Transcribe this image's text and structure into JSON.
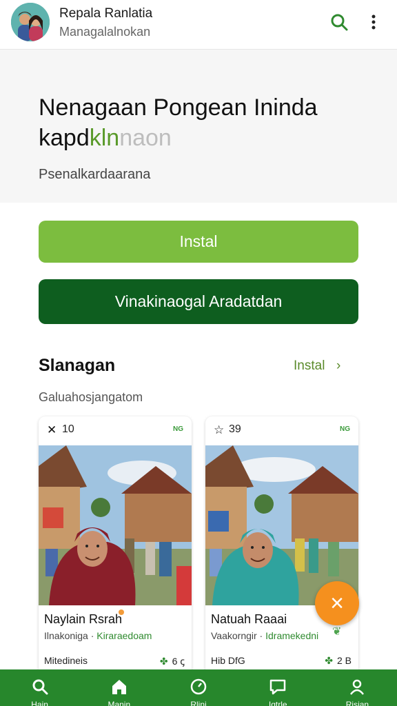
{
  "header": {
    "title": "Repala Ranlatia",
    "subtitle": "Managalalnokan",
    "avatar_icon": "couple-avatar-icon",
    "search_icon": "search-icon",
    "more_icon": "more-vertical-icon"
  },
  "hero": {
    "title_line1": "Nenagaan Pongean Ininda",
    "title_line2_dark": "kapd",
    "title_line2_green": "kln",
    "title_line2_grey": "naon",
    "subtitle": "Psenalkardaarana"
  },
  "buttons": {
    "install": "Instal",
    "secondary": "Vinakinaogal Aradatdan"
  },
  "section": {
    "title": "Slanagan",
    "link": "Instal",
    "link_chevron": "›",
    "subtitle": "Galuahosjangatom"
  },
  "cards": [
    {
      "top_icon": "✕",
      "top_number": "10",
      "badge": "NG",
      "name": "Naylain Rsrah",
      "desc_prefix": "Ilnakoniga · ",
      "desc_green": "Kiraraedoam",
      "foot": "Mitedineis",
      "meta_value": "6",
      "meta_suffix": "ꞔ",
      "scarf_color": "#8a1f2a"
    },
    {
      "top_icon": "☆",
      "top_number": "39",
      "badge": "NG",
      "name": "Natuah Raaai",
      "desc_prefix": "Vaakorngir · ",
      "desc_green": "Idramekedni",
      "foot": "Hib DfG",
      "meta_value": "2",
      "meta_suffix": "B",
      "scarf_color": "#2fa39e"
    }
  ],
  "fab": {
    "label": "×",
    "icon": "close-icon"
  },
  "nav": [
    {
      "label": "Hain",
      "icon": "search-icon"
    },
    {
      "label": "Manin",
      "icon": "home-icon"
    },
    {
      "label": "Rlini",
      "icon": "compass-icon"
    },
    {
      "label": "Iqtrle",
      "icon": "chat-icon"
    },
    {
      "label": "Risian",
      "icon": "profile-icon"
    }
  ],
  "colors": {
    "accent_green": "#7cbd3f",
    "dark_green": "#0e5e1f",
    "nav_green": "#27872c",
    "fab_orange": "#f5901e"
  }
}
